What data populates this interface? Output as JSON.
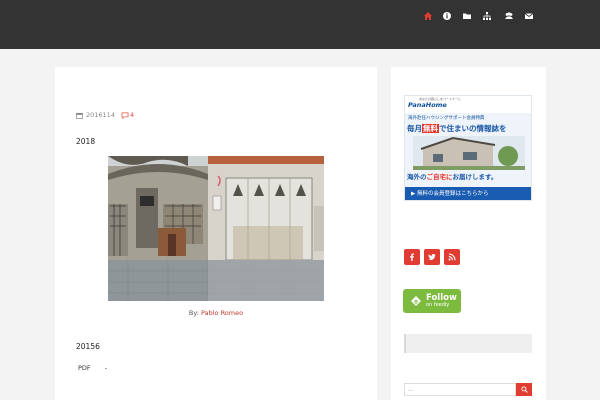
{
  "colors": {
    "topbar": "#333333",
    "accent": "#e03c31",
    "page_bg": "#f3f3f3",
    "feedly_green": "#7dbb3e"
  },
  "nav": {
    "items": [
      {
        "name": "home",
        "icon": "home-icon"
      },
      {
        "name": "info",
        "icon": "info-icon"
      },
      {
        "name": "folder",
        "icon": "folder-icon"
      },
      {
        "name": "sitemap",
        "icon": "sitemap-icon"
      },
      {
        "name": "users",
        "icon": "users-icon"
      },
      {
        "name": "mail",
        "icon": "mail-icon"
      }
    ]
  },
  "article": {
    "date": "2016114",
    "comment_count": "4",
    "heading": "2018",
    "image_caption_prefix": "By:",
    "image_author": "Pablo Romeo",
    "section_number": "20156",
    "pdf_label": "PDF",
    "pdf_value": "-"
  },
  "sidebar": {
    "ad": {
      "small_text": "あなたの暮らしをパートナーに",
      "brand": "PanaHome",
      "sub": "海外赴任ハウジングサポート会員特典",
      "headline_part1": "毎月",
      "headline_red": "無料",
      "headline_part2": "で住まいの情報誌を",
      "line2_part1": "海外の",
      "line2_red": "ご自宅に",
      "line2_part2": "お届けします。",
      "cta": "▶ 無料の会員登録はこちらから"
    },
    "social": [
      {
        "name": "facebook",
        "icon": "facebook-icon"
      },
      {
        "name": "twitter",
        "icon": "twitter-icon"
      },
      {
        "name": "rss",
        "icon": "rss-icon"
      }
    ],
    "feedly": {
      "label": "Follow",
      "sub": "on feedly"
    },
    "search": {
      "placeholder": "..."
    }
  }
}
